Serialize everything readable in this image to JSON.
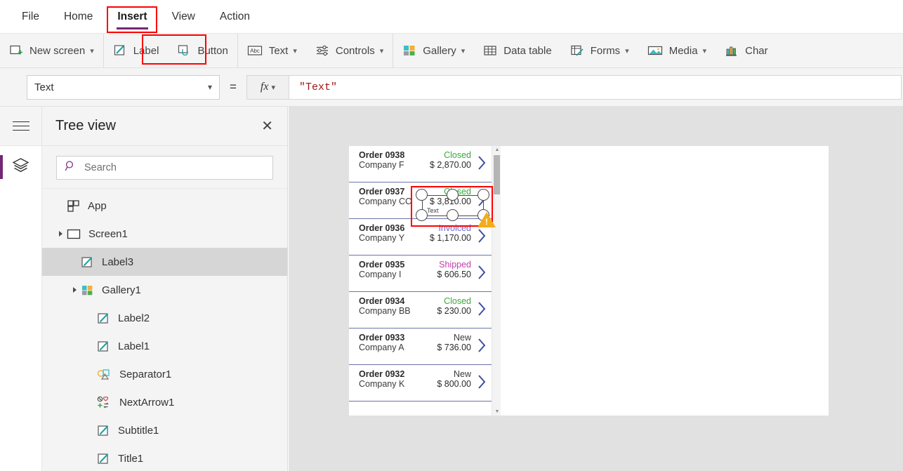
{
  "menubar": {
    "items": [
      {
        "label": "File",
        "active": false
      },
      {
        "label": "Home",
        "active": false
      },
      {
        "label": "Insert",
        "active": true
      },
      {
        "label": "View",
        "active": false
      },
      {
        "label": "Action",
        "active": false
      }
    ],
    "accent_color": "#742774",
    "annotation_color": "#ff0000"
  },
  "ribbon": {
    "items": [
      {
        "label": "New screen",
        "icon": "new-screen-icon",
        "caret": true
      },
      {
        "label": "Label",
        "icon": "label-icon",
        "caret": false,
        "highlighted": true
      },
      {
        "label": "Button",
        "icon": "button-icon",
        "caret": false
      },
      {
        "label": "Text",
        "icon": "abc-text-icon",
        "caret": true
      },
      {
        "label": "Controls",
        "icon": "sliders-icon",
        "caret": true
      },
      {
        "label": "Gallery",
        "icon": "gallery-icon",
        "caret": true
      },
      {
        "label": "Data table",
        "icon": "data-table-icon",
        "caret": false
      },
      {
        "label": "Forms",
        "icon": "forms-icon",
        "caret": true
      },
      {
        "label": "Media",
        "icon": "media-image-icon",
        "caret": true
      },
      {
        "label": "Char",
        "icon": "charts-icon",
        "caret": false
      }
    ]
  },
  "formula_bar": {
    "property": "Text",
    "equals": "=",
    "fx_label": "fx",
    "value": "\"Text\"",
    "value_color": "#a31515"
  },
  "left_rail": {
    "menu_icon": "hamburger-menu-icon",
    "layers_icon": "layers-icon"
  },
  "tree_view": {
    "title": "Tree view",
    "close_icon": "close-icon",
    "search": {
      "placeholder": "Search",
      "value": "",
      "icon": "search-icon"
    },
    "nodes": [
      {
        "label": "App",
        "icon": "app-icon",
        "indent": 0,
        "caret": "none",
        "selected": false
      },
      {
        "label": "Screen1",
        "icon": "screen-icon",
        "indent": 0,
        "caret": "collapsed",
        "selected": false
      },
      {
        "label": "Label3",
        "icon": "label-icon",
        "indent": 1,
        "caret": "none",
        "selected": true
      },
      {
        "label": "Gallery1",
        "icon": "gallery-icon",
        "indent": 1,
        "caret": "collapsed",
        "selected": false
      },
      {
        "label": "Label2",
        "icon": "label-icon",
        "indent": 2,
        "caret": "none",
        "selected": false
      },
      {
        "label": "Label1",
        "icon": "label-icon",
        "indent": 2,
        "caret": "none",
        "selected": false
      },
      {
        "label": "Separator1",
        "icon": "separator-icon",
        "indent": 2,
        "caret": "none",
        "selected": false
      },
      {
        "label": "NextArrow1",
        "icon": "next-arrow-icon",
        "indent": 2,
        "caret": "none",
        "selected": false
      },
      {
        "label": "Subtitle1",
        "icon": "label-icon",
        "indent": 2,
        "caret": "none",
        "selected": false
      },
      {
        "label": "Title1",
        "icon": "label-icon",
        "indent": 2,
        "caret": "none",
        "selected": false
      }
    ]
  },
  "canvas": {
    "selected_control": {
      "text": "Text",
      "warning_icon": "warning-triangle-icon",
      "selection_border_color": "#ff0000"
    },
    "gallery": {
      "items": [
        {
          "title": "Order 0938",
          "subtitle": "Company F",
          "status": "Closed",
          "amount": "$ 2,870.00",
          "status_color": "#3aa83a"
        },
        {
          "title": "Order 0937",
          "subtitle": "Company CC",
          "status": "Closed",
          "amount": "$ 3,810.00",
          "status_color": "#3aa83a"
        },
        {
          "title": "Order 0936",
          "subtitle": "Company Y",
          "status": "Invoiced",
          "amount": "$ 1,170.00",
          "status_color": "#6b6bdb"
        },
        {
          "title": "Order 0935",
          "subtitle": "Company I",
          "status": "Shipped",
          "amount": "$ 606.50",
          "status_color": "#c23fa8"
        },
        {
          "title": "Order 0934",
          "subtitle": "Company BB",
          "status": "Closed",
          "amount": "$ 230.00",
          "status_color": "#3aa83a"
        },
        {
          "title": "Order 0933",
          "subtitle": "Company A",
          "status": "New",
          "amount": "$ 736.00",
          "status_color": "#3a3a3a"
        },
        {
          "title": "Order 0932",
          "subtitle": "Company K",
          "status": "New",
          "amount": "$ 800.00",
          "status_color": "#3a3a3a"
        }
      ],
      "chevron_icon": "chevron-right-icon",
      "scrollbar": "vertical-scrollbar"
    }
  }
}
